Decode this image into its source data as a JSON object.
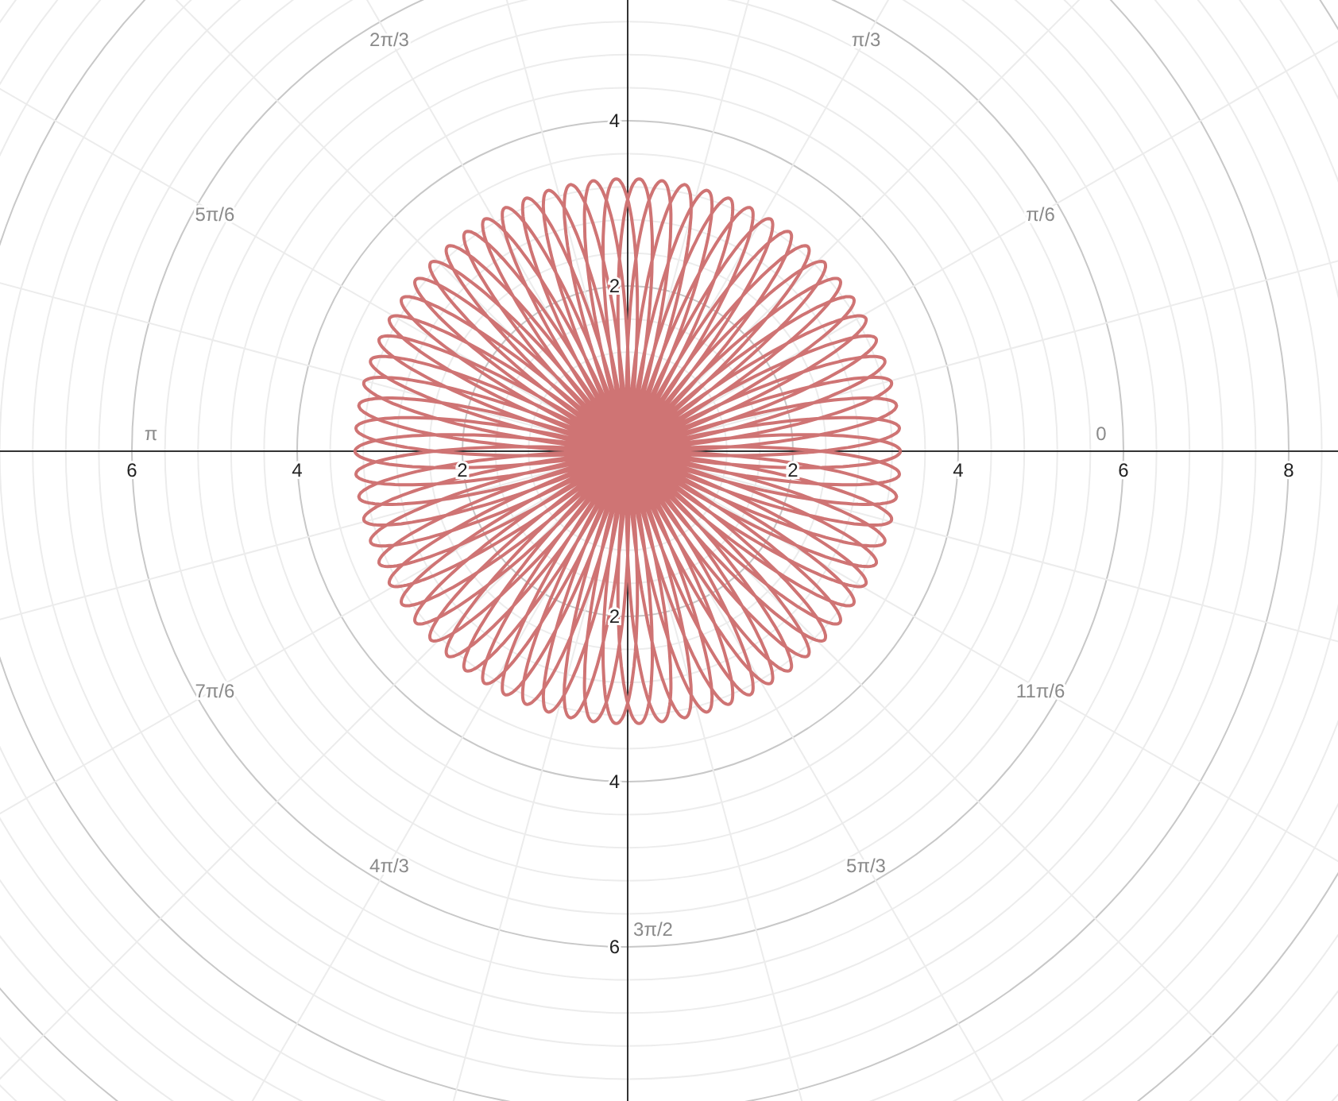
{
  "graph": {
    "x_tick_labels": [
      "6",
      "4",
      "2",
      "2",
      "4",
      "6",
      "8"
    ],
    "y_tick_labels": [
      "4",
      "2",
      "2",
      "4",
      "6"
    ],
    "angle_labels": [
      "2π/3",
      "π/3",
      "5π/6",
      "π/6",
      "π",
      "0",
      "7π/6",
      "11π/6",
      "4π/3",
      "5π/3",
      "3π/2"
    ]
  }
}
